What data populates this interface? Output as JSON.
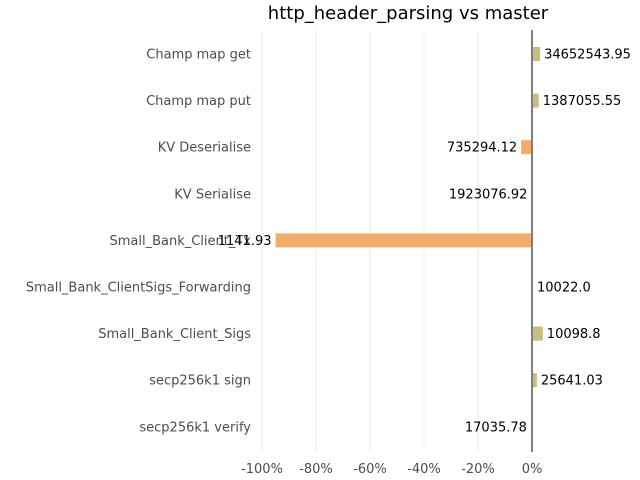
{
  "chart_data": {
    "type": "bar",
    "orientation": "horizontal",
    "title": "http_header_parsing vs master",
    "xlabel": "",
    "ylabel": "",
    "xlim": [
      -1.0,
      0.0
    ],
    "xticks": [
      {
        "value": -1.0,
        "label": "-100%"
      },
      {
        "value": -0.8,
        "label": "-80%"
      },
      {
        "value": -0.6,
        "label": "-60%"
      },
      {
        "value": -0.4,
        "label": "-40%"
      },
      {
        "value": -0.2,
        "label": "-20%"
      },
      {
        "value": 0.0,
        "label": "0%"
      }
    ],
    "grid": true,
    "legend": "none",
    "categories": [
      "Champ map get",
      "Champ map put",
      "KV Deserialise",
      "KV Serialise",
      "Small_Bank_Client_Tx",
      "Small_Bank_ClientSigs_Forwarding",
      "Small_Bank_Client_Sigs",
      "secp256k1 sign",
      "secp256k1 verify"
    ],
    "values": [
      0.03,
      0.025,
      -0.04,
      -0.002,
      -0.95,
      0.0,
      0.04,
      0.018,
      -0.004
    ],
    "labels": [
      "34652543.95",
      "1387055.55",
      "735294.12",
      "1923076.92",
      "1141.93",
      "10022.0",
      "10098.8",
      "25641.03",
      "17035.78"
    ],
    "colors": {
      "positive": "#c8bd80",
      "negative": "#f4ac6d",
      "zero_line": "#7f7f7f",
      "grid": "#ebebeb"
    }
  }
}
